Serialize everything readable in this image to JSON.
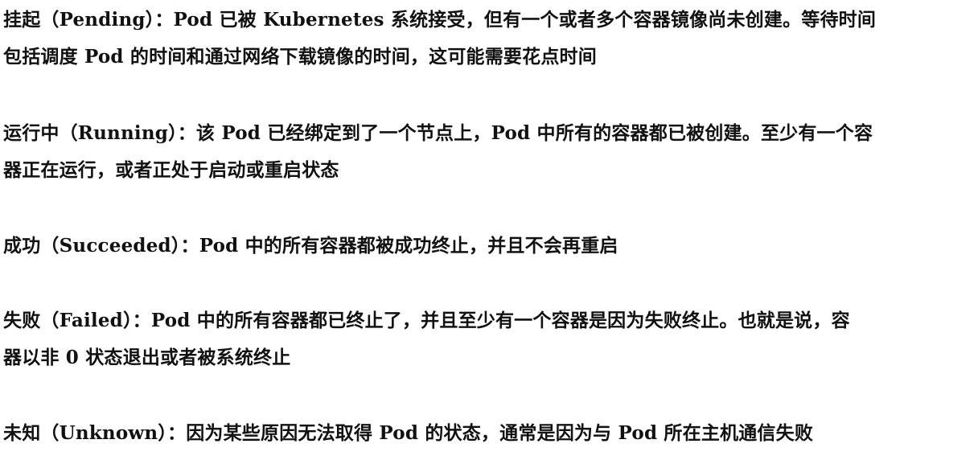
{
  "paragraphs": [
    {
      "lines": [
        "挂起（Pending）：Pod 已被 Kubernetes 系统接受，但有一个或者多个容器镜像尚未创建。等待时间",
        "包括调度 Pod 的时间和通过网络下载镜像的时间，这可能需要花点时间"
      ]
    },
    {
      "lines": [
        "运行中（Running）：该 Pod 已经绑定到了一个节点上，Pod 中所有的容器都已被创建。至少有一个容",
        "器正在运行，或者正处于启动或重启状态"
      ]
    },
    {
      "lines": [
        "成功（Succeeded）：Pod 中的所有容器都被成功终止，并且不会再重启"
      ]
    },
    {
      "lines": [
        "失败（Failed）：Pod 中的所有容器都已终止了，并且至少有一个容器是因为失败终止。也就是说，容",
        "器以非 0 状态退出或者被系统终止"
      ]
    },
    {
      "lines": [
        "未知（Unknown）：因为某些原因无法取得 Pod 的状态，通常是因为与 Pod 所在主机通信失败"
      ]
    }
  ]
}
